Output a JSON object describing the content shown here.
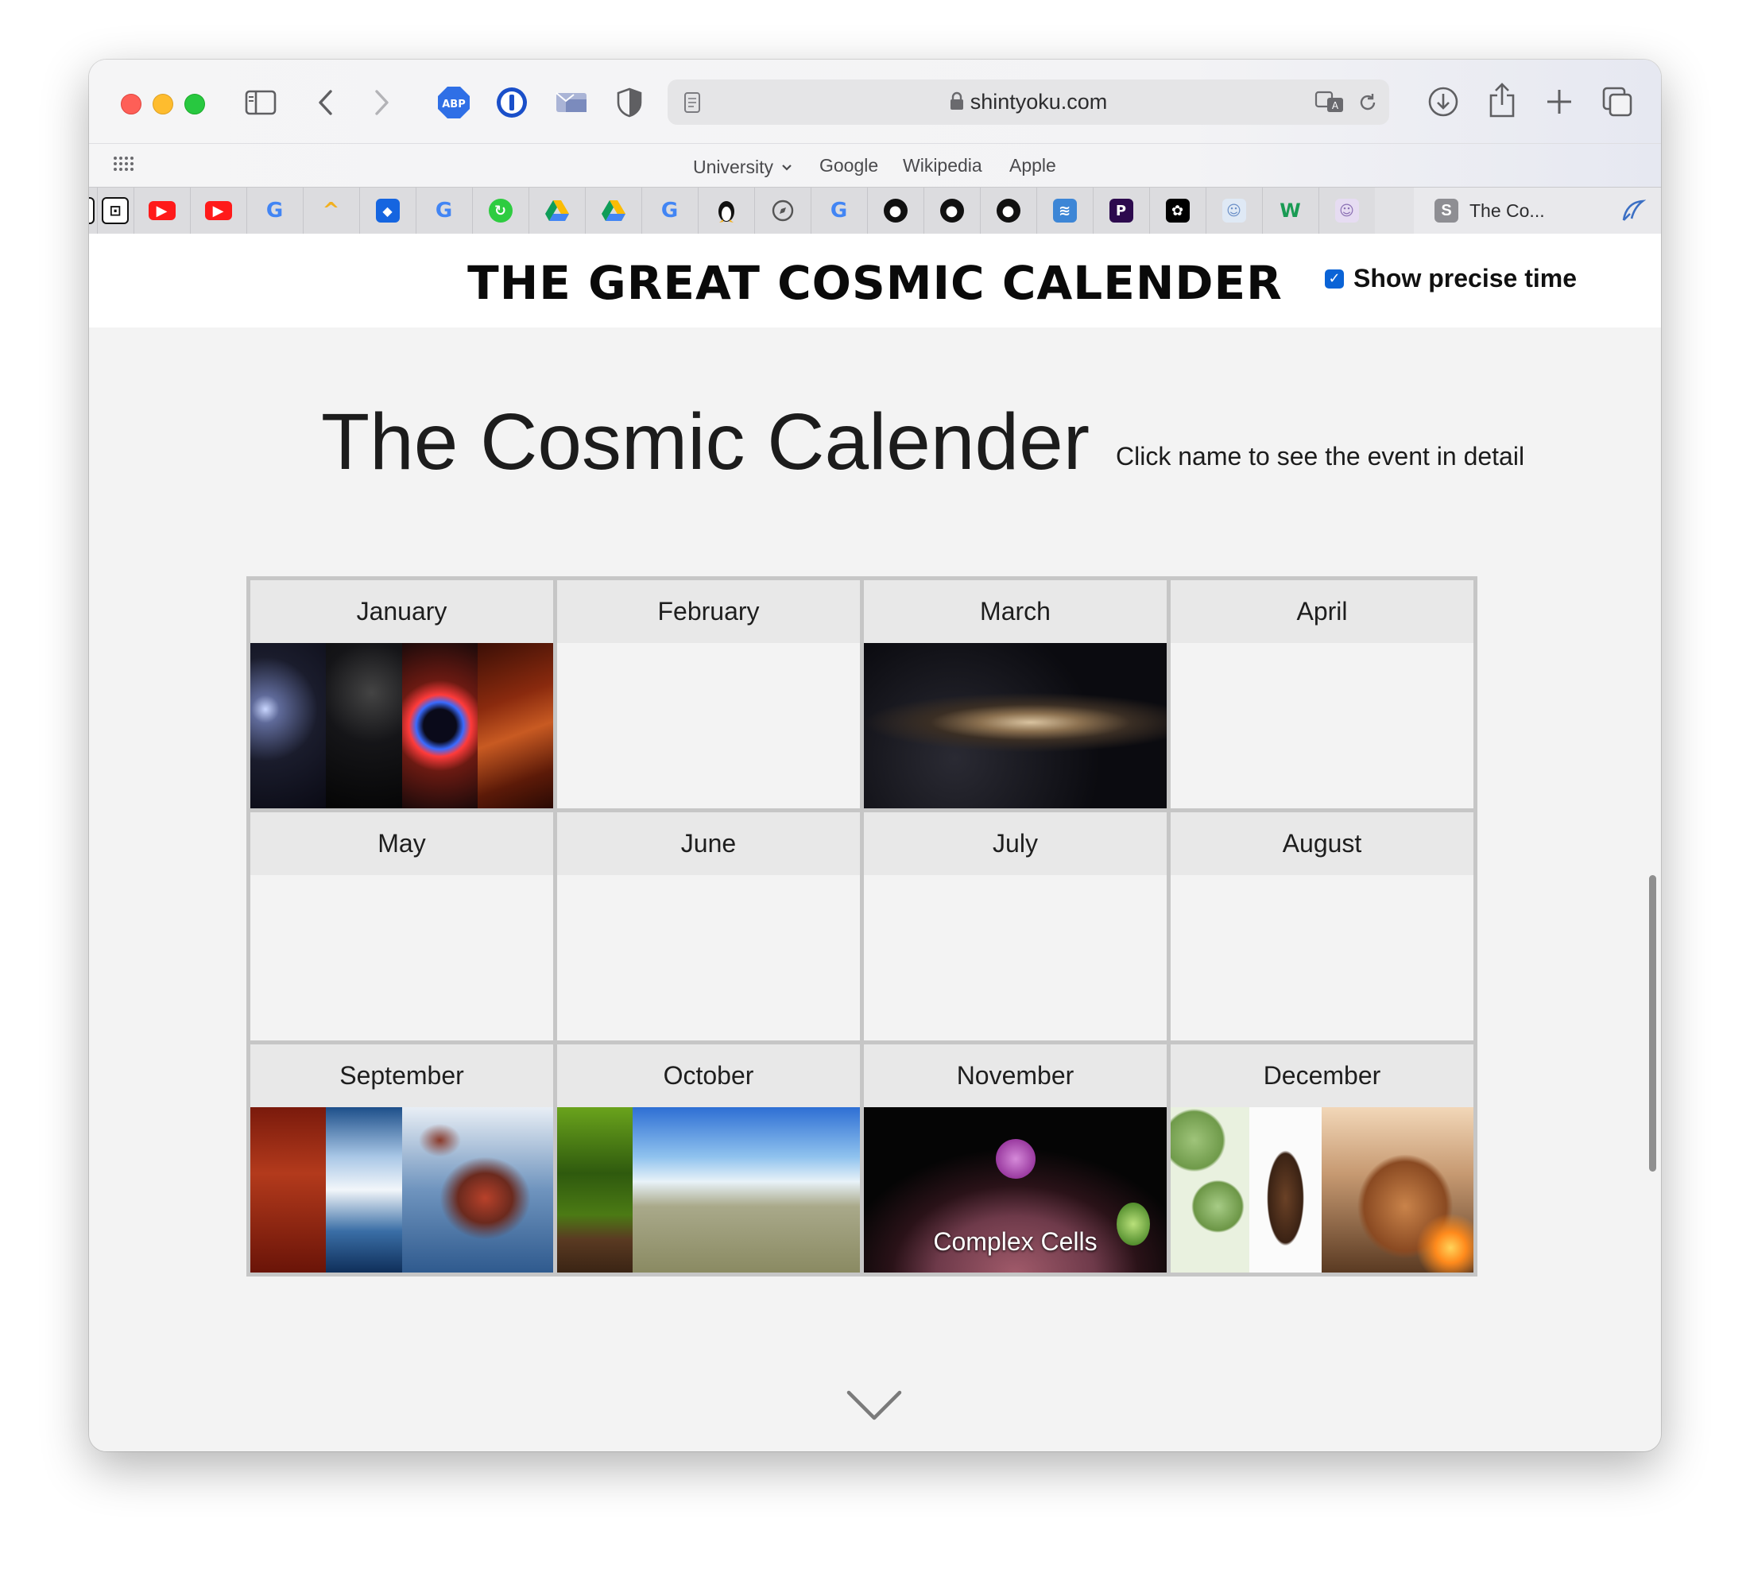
{
  "toolbar": {
    "url": "shintyoku.com",
    "extensions": [
      "adblock-plus-icon",
      "1password-icon",
      "mail-extension-icon",
      "shield-extension-icon"
    ]
  },
  "bookmarks": {
    "items": [
      {
        "label": "University",
        "has_menu": true
      },
      {
        "label": "Google"
      },
      {
        "label": "Wikipedia"
      },
      {
        "label": "Apple"
      }
    ]
  },
  "tabs": {
    "active_badge": "S",
    "active_title": "The Co..."
  },
  "site": {
    "title": "THE GREAT COSMIC CALENDER",
    "precise_time_label": "Show precise time",
    "precise_time_checked": true
  },
  "calendar": {
    "title": "The Cosmic Calender",
    "hint": "Click name to see the event in detail",
    "months": [
      {
        "name": "January",
        "image": "big-bang-collage"
      },
      {
        "name": "February",
        "image": ""
      },
      {
        "name": "March",
        "image": "milky-way"
      },
      {
        "name": "April",
        "image": ""
      },
      {
        "name": "May",
        "image": ""
      },
      {
        "name": "June",
        "image": ""
      },
      {
        "name": "July",
        "image": ""
      },
      {
        "name": "August",
        "image": ""
      },
      {
        "name": "September",
        "image": "early-earth-collage"
      },
      {
        "name": "October",
        "image": "early-life-collage"
      },
      {
        "name": "November",
        "image": "complex-cells",
        "label": "Complex Cells"
      },
      {
        "name": "December",
        "image": "human-evolution-collage"
      }
    ]
  },
  "colors": {
    "accent": "#0a63d6",
    "page_bg": "#f3f3f3",
    "grid_border": "#c6c6c6",
    "month_header_bg": "#e8e8e8"
  }
}
